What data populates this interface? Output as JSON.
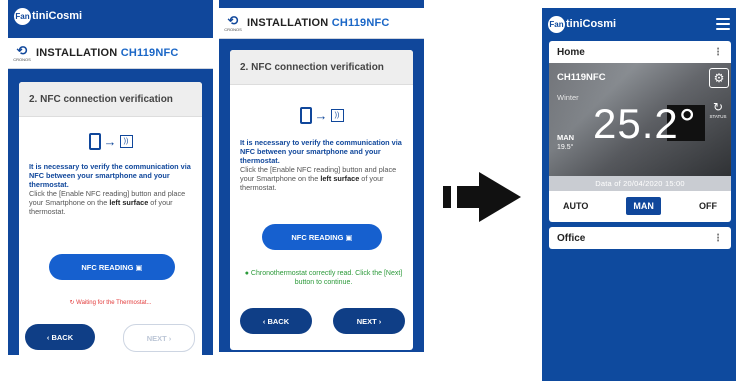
{
  "brand": {
    "name_prefix": "Fan",
    "name_suffix": "tiniCosmi"
  },
  "installation": {
    "icon_caption": "CRONOS",
    "title": "INSTALLATION",
    "device_code": "CH119NFC"
  },
  "step": {
    "title": "2. NFC connection verification",
    "lead_text": "It is necessary to verify the communication via NFC between your smartphone and your thermostat.",
    "instruction_before": "Click the [Enable NFC reading] button and place your Smartphone on the ",
    "instruction_bold1": "left",
    "instruction_middle": " ",
    "instruction_bold2": "surface",
    "instruction_after": " of your thermostat.",
    "nfc_button_label": "NFC READING",
    "back_label": "‹ BACK",
    "next_label": "NEXT ›",
    "waiting_status": "Waiting for the Thermostat...",
    "success_status": "Chronothermostat correctly read. Click the [Next] button to continue."
  },
  "app": {
    "home_label": "Home",
    "device_name": "CH119NFC",
    "season": "Winter",
    "temperature": "25.2°",
    "mode_badge": "MAN",
    "set_temperature": "19.5°",
    "status_caption": "STATUS",
    "date_text": "Data of 20/04/2020 15:00",
    "modes": [
      "AUTO",
      "MAN",
      "OFF"
    ],
    "active_mode": "MAN",
    "office_label": "Office",
    "more_glyph": "⋮"
  },
  "colors": {
    "app_blue": "#10479b",
    "button_blue": "#1660cf",
    "success_green": "#2c9a3a",
    "error_red": "#e23a3a"
  },
  "icons": [
    "fan-logo-icon",
    "installation-icon",
    "phone-icon",
    "nfc-icon",
    "settings-icon",
    "refresh-icon",
    "menu-icon",
    "arrow-right-icon",
    "check-icon",
    "spinner-icon"
  ]
}
